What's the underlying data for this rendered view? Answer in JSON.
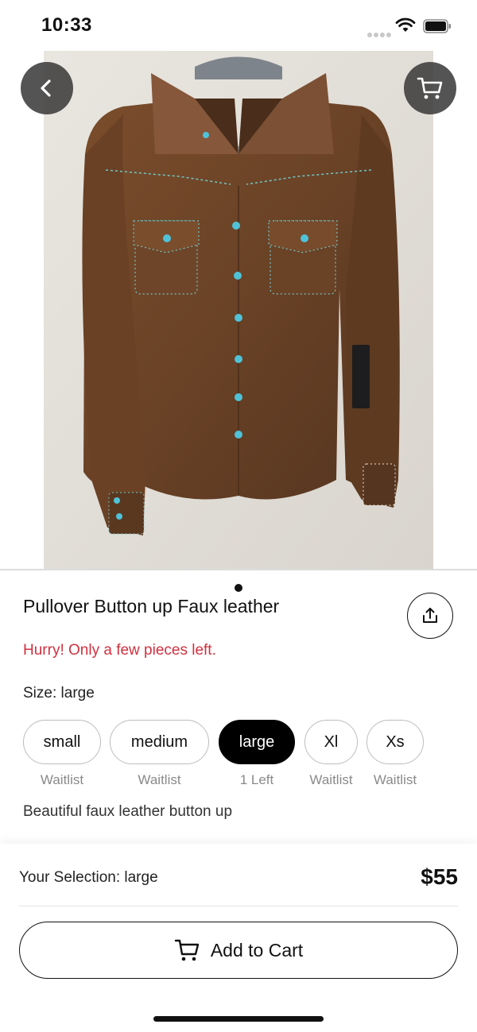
{
  "status_bar": {
    "time": "10:33"
  },
  "product": {
    "title": "Pullover Button up Faux leather",
    "stock_warning": "Hurry! Only a few pieces left.",
    "size_label_prefix": "Size:",
    "size_selected": "large",
    "description": "Beautiful faux leather button up",
    "image_page_count": 1,
    "image_current_page": 1
  },
  "sizes": [
    {
      "label": "small",
      "status": "Waitlist",
      "selected": false
    },
    {
      "label": "medium",
      "status": "Waitlist",
      "selected": false
    },
    {
      "label": "large",
      "status": "1 Left",
      "selected": true
    },
    {
      "label": "Xl",
      "status": "Waitlist",
      "selected": false
    },
    {
      "label": "Xs",
      "status": "Waitlist",
      "selected": false
    }
  ],
  "checkout": {
    "selection_text": "Your Selection: large",
    "price": "$55",
    "add_to_cart_label": "Add to Cart"
  },
  "colors": {
    "warning": "#d1313f",
    "selected_chip": "#000000",
    "shirt": "#6b4326",
    "stitch": "#6ec6c9"
  },
  "icons": {
    "back": "chevron-left-icon",
    "cart": "cart-icon",
    "share": "share-icon"
  }
}
